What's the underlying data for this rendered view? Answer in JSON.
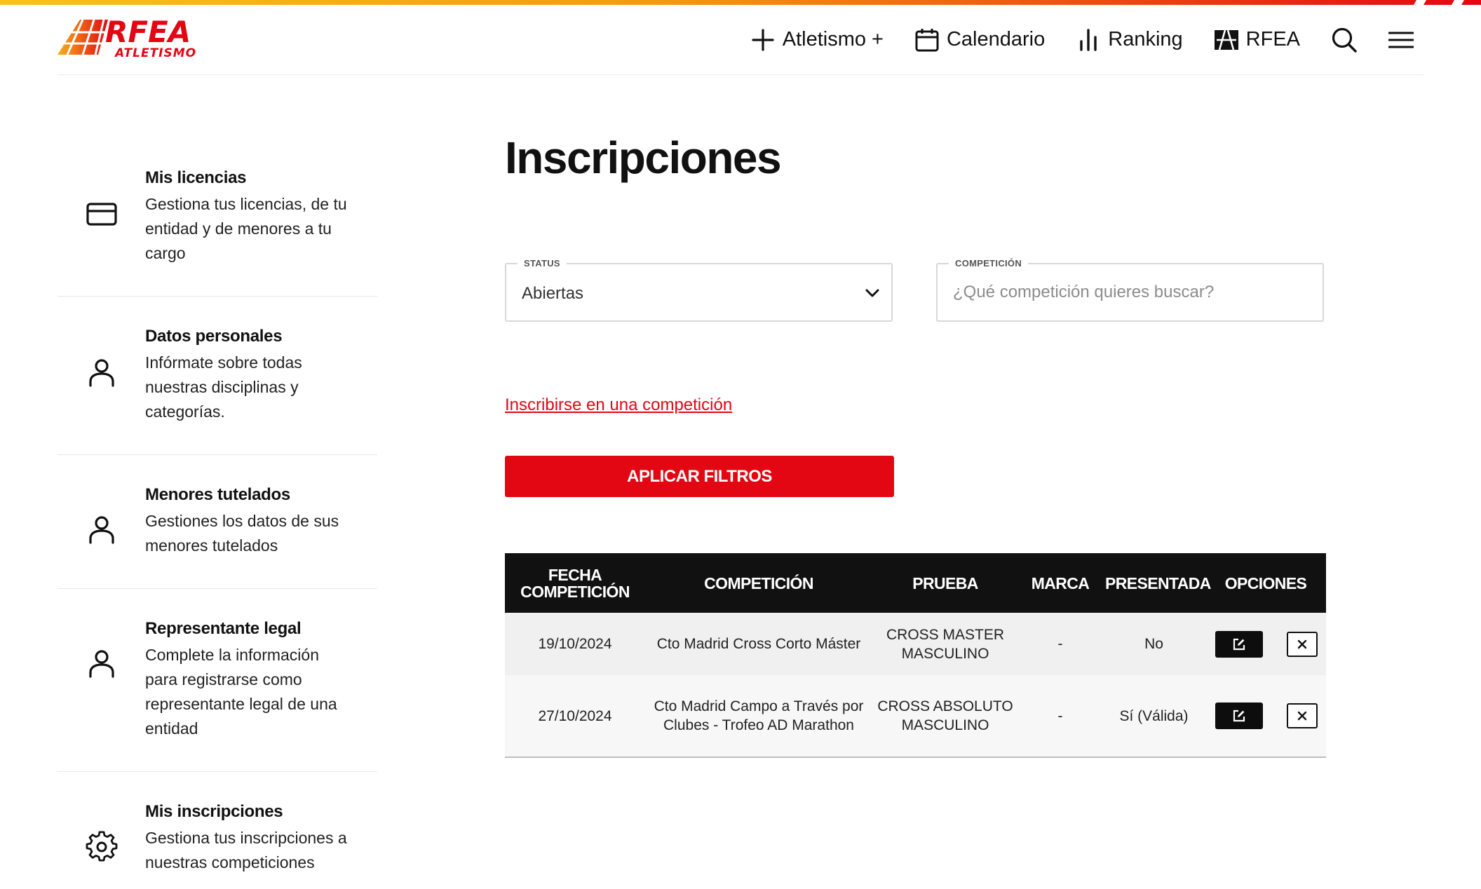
{
  "brand": {
    "name": "RFEA",
    "sub": "ATLETISMO",
    "colors": {
      "red": "#e30613",
      "orange": "#f39a12",
      "yellow": "#f7c31c",
      "black": "#111111"
    }
  },
  "nav": {
    "items": [
      {
        "label": "Atletismo +",
        "icon": "plus-icon"
      },
      {
        "label": "Calendario",
        "icon": "calendar-icon"
      },
      {
        "label": "Ranking",
        "icon": "bar-chart-icon"
      },
      {
        "label": "RFEA",
        "icon": "rfea-emblem-icon"
      }
    ],
    "search_icon": "search-icon",
    "menu_icon": "hamburger-menu-icon"
  },
  "sidebar": {
    "items": [
      {
        "title": "Mis licencias",
        "description": "Gestiona tus licencias, de tu entidad y de menores a tu cargo",
        "icon": "card-icon"
      },
      {
        "title": "Datos personales",
        "description": "Infórmate sobre todas nuestras disciplinas y categorías.",
        "icon": "user-icon"
      },
      {
        "title": "Menores tutelados",
        "description": "Gestiones los datos de sus menores tutelados",
        "icon": "user-icon"
      },
      {
        "title": "Representante legal",
        "description": "Complete la información para registrarse como representante legal de una entidad",
        "icon": "user-icon"
      },
      {
        "title": "Mis inscripciones",
        "description": "Gestiona tus inscripciones a nuestras competiciones",
        "icon": "gear-icon"
      }
    ]
  },
  "main": {
    "title": "Inscripciones",
    "filters": {
      "status": {
        "label": "STATUS",
        "value": "Abiertas"
      },
      "competicion": {
        "label": "COMPETICIÓN",
        "value": "",
        "placeholder": "¿Qué competición quieres buscar?"
      }
    },
    "register_link": "Inscribirse en una competición",
    "apply_button": "APLICAR FILTROS",
    "table": {
      "headers": [
        "FECHA COMPETICIÓN",
        "COMPETICIÓN",
        "PRUEBA",
        "MARCA",
        "PRESENTADA",
        "OPCIONES"
      ],
      "rows": [
        {
          "fecha": "19/10/2024",
          "competicion": "Cto Madrid Cross Corto Máster",
          "prueba": "CROSS MASTER MASCULINO",
          "marca": "-",
          "presentada": "No",
          "edit_icon": "edit-icon",
          "delete_icon": "close-icon"
        },
        {
          "fecha": "27/10/2024",
          "competicion": "Cto Madrid Campo a Través por Clubes - Trofeo AD Marathon",
          "prueba": "CROSS ABSOLUTO MASCULINO",
          "marca": "-",
          "presentada": "Sí (Válida)",
          "edit_icon": "edit-icon",
          "delete_icon": "close-icon"
        }
      ]
    }
  }
}
